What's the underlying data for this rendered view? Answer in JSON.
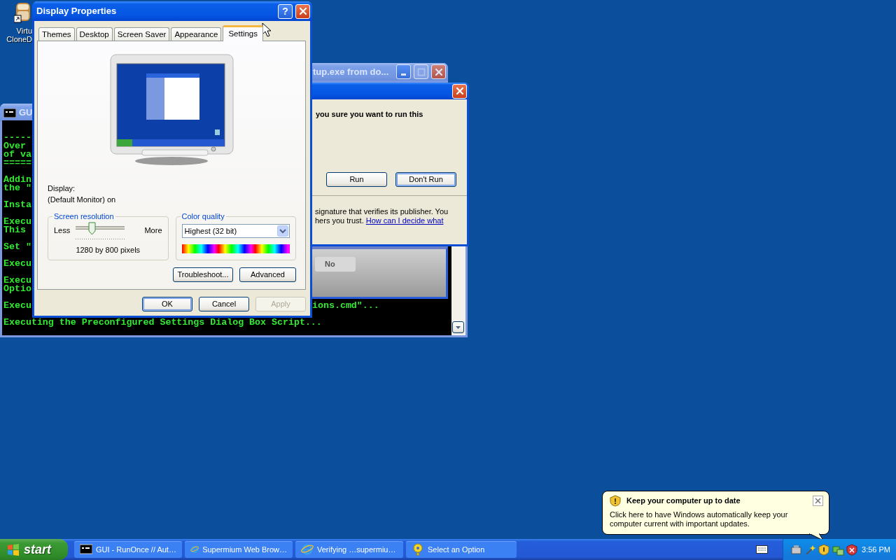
{
  "desktop_icon": {
    "label_lines": [
      "Virtu",
      "CloneD"
    ]
  },
  "console": {
    "title": "GU",
    "lines": [
      {
        "text": "-----",
        "blank_before": false
      },
      {
        "text": "Over",
        "blank_before": false
      },
      {
        "text": "of va",
        "blank_before": false
      },
      {
        "text": "=====",
        "blank_before": false
      },
      {
        "text": "Addin",
        "blank_before": true
      },
      {
        "text": "the \"",
        "blank_before": false
      },
      {
        "text": "Insta",
        "blank_before": true
      },
      {
        "text": "Execu",
        "blank_before": true
      },
      {
        "text": "This",
        "blank_before": false
      },
      {
        "text": "Set \"",
        "blank_before": true
      },
      {
        "text": "Execu",
        "blank_before": true
      },
      {
        "text": "Execu",
        "blank_before": true
      },
      {
        "text": "Optio",
        "blank_before": false
      },
      {
        "text": "Execu",
        "blank_before": true,
        "tail": "ions.cmd\"..."
      },
      {
        "text": "Executing the Preconfigured Settings Dialog Box Script...",
        "blank_before": true
      }
    ]
  },
  "download_window": {
    "title": "tup.exe from do..."
  },
  "security_dialog": {
    "question": "you sure you want to run this",
    "buttons": [
      {
        "label": "Run",
        "default": false
      },
      {
        "label": "Don't Run",
        "default": true
      }
    ],
    "notice_lines": [
      "signature that verifies its publisher. You",
      "hers you trust."
    ],
    "link": "How can I decide what"
  },
  "script_dialog": {
    "button": "No"
  },
  "display_properties": {
    "title": "Display Properties",
    "help": "?",
    "tabs": [
      {
        "label": "Themes",
        "selected": false
      },
      {
        "label": "Desktop",
        "selected": false
      },
      {
        "label": "Screen Saver",
        "selected": false
      },
      {
        "label": "Appearance",
        "selected": false
      },
      {
        "label": "Settings",
        "selected": true
      }
    ],
    "display_label": "Display:",
    "display_value": "(Default Monitor) on",
    "resolution": {
      "legend": "Screen resolution",
      "less": "Less",
      "more": "More",
      "level": 0.3,
      "reading": "1280 by 800 pixels"
    },
    "color_quality": {
      "legend": "Color quality",
      "value": "Highest (32 bit)"
    },
    "panel_buttons": [
      {
        "label": "Troubleshoot..."
      },
      {
        "label": "Advanced"
      }
    ],
    "buttons": [
      {
        "label": "OK",
        "default": true,
        "disabled": false
      },
      {
        "label": "Cancel",
        "default": false,
        "disabled": false
      },
      {
        "label": "Apply",
        "default": false,
        "disabled": true
      }
    ]
  },
  "balloon": {
    "title": "Keep your computer up to date",
    "text": "Click here to have Windows automatically keep your computer current with important updates."
  },
  "taskbar": {
    "start": "start",
    "tasks": [
      {
        "label": "GUI - RunOnce // Aut…",
        "kind": "console"
      },
      {
        "label": "Supermium Web Brow…",
        "kind": "browser"
      },
      {
        "label": "Verifying …supermiu…",
        "kind": "browser"
      },
      {
        "label": "Select an Option",
        "kind": "help"
      }
    ],
    "clock": "3:56 PM"
  }
}
